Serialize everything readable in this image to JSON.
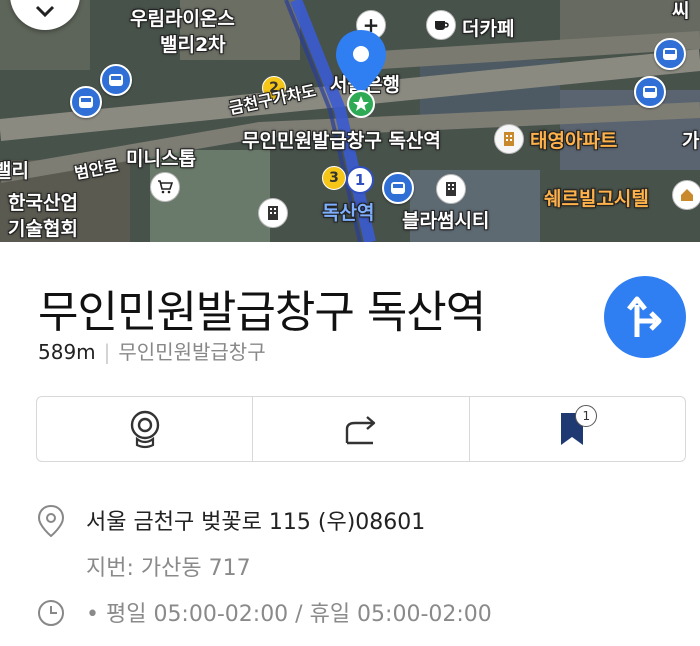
{
  "map": {
    "labels": {
      "urim_valley_line1": "우림라이온스",
      "urim_valley_line2": "밸리2차",
      "the_cafe": "더카페",
      "ssi": "씨",
      "geumcheon_road": "금천구가차도",
      "seoul_bank": "서울은행",
      "civil_station": "무인민원발급창구 독산역",
      "taeyoung_apt": "태영아파트",
      "valley": "밸리",
      "beoman_ro": "범안로",
      "mini_stop": "미니스톱",
      "korea_industry_line1": "한국산업",
      "korea_industry_line2": "기술협회",
      "doksan_station": "독산역",
      "blossom_city": "블라썸시티",
      "sherville_hotel": "쉐르빌고시텔",
      "ga": "가"
    },
    "markers": {
      "num1": "1",
      "num2": "2",
      "num3": "3"
    }
  },
  "place": {
    "title": "무인민원발급창구 독산역",
    "distance": "589m",
    "category": "무인민원발급창구"
  },
  "actions": {
    "bookmark_count": "1"
  },
  "info": {
    "address": "서울 금천구 벚꽃로 115 (우)08601",
    "jibun": "지번: 가산동 717",
    "hours": "• 평일 05:00-02:00 / 휴일 05:00-02:00"
  }
}
